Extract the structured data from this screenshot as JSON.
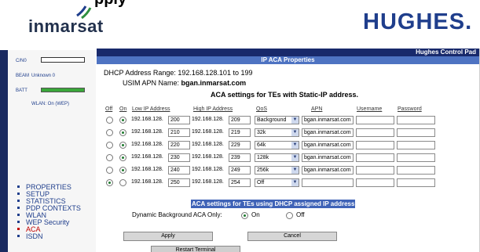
{
  "header": {
    "partial_title": "pply",
    "inmarsat_logo_text": "inmarsat",
    "hughes_logo_text": "HUGHES."
  },
  "status_panel": {
    "cn_label": "C/N0",
    "beam_label": "BEAM",
    "beam_value": "Unknown 0",
    "batt_label": "BATT",
    "wlan_status": "WLAN: On (WEP)"
  },
  "nav": {
    "items": [
      {
        "label": "PROPERTIES",
        "active": false
      },
      {
        "label": "SETUP",
        "active": false
      },
      {
        "label": "STATISTICS",
        "active": false
      },
      {
        "label": "PDP CONTEXTS",
        "active": false
      },
      {
        "label": "WLAN",
        "active": false
      },
      {
        "label": "WEP Security",
        "active": false
      },
      {
        "label": "ACA",
        "active": true
      },
      {
        "label": "ISDN",
        "active": false
      }
    ]
  },
  "panel": {
    "brand_bar": "Hughes Control Pad",
    "title": "IP ACA Properties",
    "dhcp_range": "DHCP Address Range: 192.168.128.101 to 199",
    "usim_apn_label": "USIM APN Name:",
    "usim_apn_value": "bgan.inmarsat.com",
    "static_section_title": "ACA settings for TEs with Static-IP address."
  },
  "table": {
    "headers": {
      "off": "Off",
      "on": "On",
      "low_ip": "Low IP Address",
      "high_ip": "High IP Address",
      "qos": "QoS",
      "apn": "APN",
      "username": "Username",
      "password": "Password"
    },
    "prefix": "192.168.128.",
    "rows": [
      {
        "selected": "on",
        "low": "200",
        "high": "209",
        "qos": "Background",
        "apn": "bgan.inmarsat.com",
        "username": "",
        "password": ""
      },
      {
        "selected": "on",
        "low": "210",
        "high": "219",
        "qos": "32k",
        "apn": "bgan.inmarsat.com",
        "username": "",
        "password": ""
      },
      {
        "selected": "on",
        "low": "220",
        "high": "229",
        "qos": "64k",
        "apn": "bgan.inmarsat.com",
        "username": "",
        "password": ""
      },
      {
        "selected": "on",
        "low": "230",
        "high": "239",
        "qos": "128k",
        "apn": "bgan.inmarsat.com",
        "username": "",
        "password": ""
      },
      {
        "selected": "on",
        "low": "240",
        "high": "249",
        "qos": "256k",
        "apn": "bgan.inmarsat.com",
        "username": "",
        "password": ""
      },
      {
        "selected": "off",
        "low": "250",
        "high": "254",
        "qos": "Off",
        "apn": "",
        "username": "",
        "password": ""
      }
    ]
  },
  "dhcp_section": {
    "title": "ACA settings for TEs using DHCP assigned IP address",
    "dynamic_label": "Dynamic Background ACA Only:",
    "option_on": "On",
    "option_off": "Off",
    "selected": "on"
  },
  "buttons": {
    "apply": "Apply",
    "cancel": "Cancel",
    "restart": "Restart Terminal"
  },
  "colors": {
    "nav_blue": "#1f3e8c",
    "active_red": "#c00000",
    "bar_dark": "#18296b",
    "bar_mid": "#4e73c2",
    "signal_green": "#3aa83a"
  }
}
